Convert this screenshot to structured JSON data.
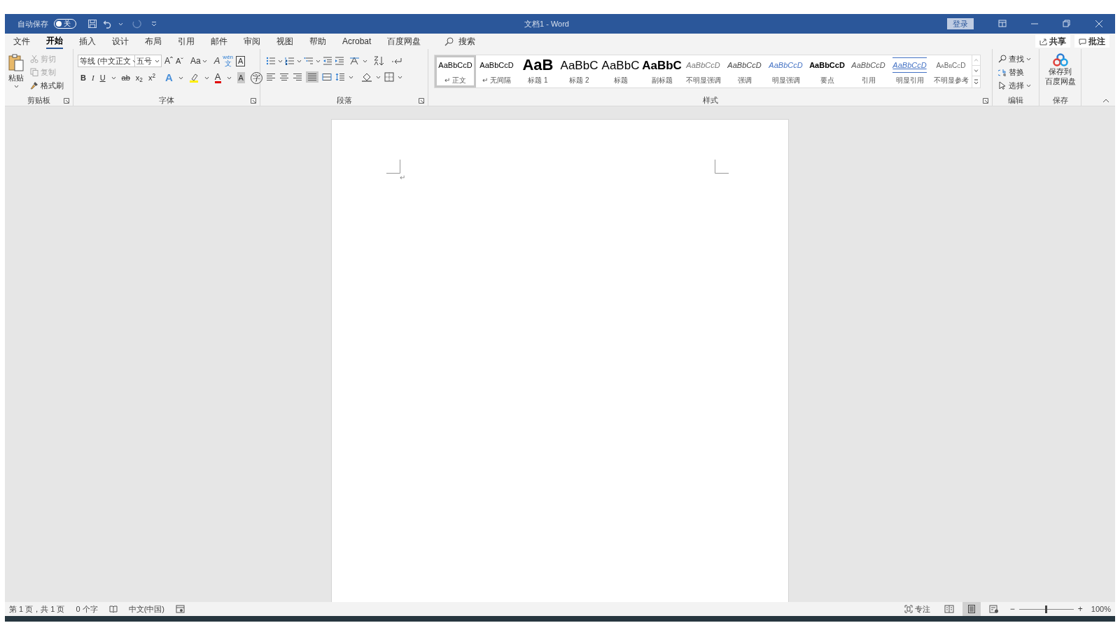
{
  "title_bar": {
    "autosave_label": "自动保存",
    "autosave": {
      "on": false,
      "label": "关"
    },
    "title": "文档1 - Word",
    "sign_in": "登录"
  },
  "tabs": [
    {
      "label": "文件",
      "selected": false
    },
    {
      "label": "开始",
      "selected": true
    },
    {
      "label": "插入",
      "selected": false
    },
    {
      "label": "设计",
      "selected": false
    },
    {
      "label": "布局",
      "selected": false
    },
    {
      "label": "引用",
      "selected": false
    },
    {
      "label": "邮件",
      "selected": false
    },
    {
      "label": "审阅",
      "selected": false
    },
    {
      "label": "视图",
      "selected": false
    },
    {
      "label": "帮助",
      "selected": false
    },
    {
      "label": "Acrobat",
      "selected": false
    },
    {
      "label": "百度网盘",
      "selected": false
    }
  ],
  "search": {
    "label": "搜索"
  },
  "share": "共享",
  "comments": "批注",
  "ribbon": {
    "clipboard": {
      "paste": "粘贴",
      "cut": {
        "label": "剪切",
        "disabled": true
      },
      "copy": {
        "label": "复制",
        "disabled": true
      },
      "format_painter": "格式刷",
      "group": "剪贴板"
    },
    "font": {
      "font_name": "等线 (中文正文",
      "font_size": "五号",
      "grow": "Aˆ",
      "shrink": "Aˇ",
      "change_case": "Aa",
      "clear": "A",
      "phonetic": {
        "ruby": "wén",
        "label": "文"
      },
      "border": "A",
      "format_buttons": [
        "B",
        "I",
        "U",
        "ab",
        "x$_{2}$",
        "x$^{2}$"
      ],
      "text_effect": "A",
      "font_color": "A",
      "shading": "A",
      "enclose": "字",
      "group": "字体"
    },
    "paragraph": {
      "group": "段落"
    },
    "styles": {
      "group": "样式",
      "items": [
        {
          "kind": "normal",
          "preview": "AaBbCcD",
          "label": "↵ 正文",
          "selected": true
        },
        {
          "kind": "normal",
          "preview": "AaBbCcD",
          "label": "↵ 无间隔",
          "selected": false
        },
        {
          "kind": "heading1",
          "preview": "AaB",
          "label": "标题 1",
          "selected": false
        },
        {
          "kind": "heading2",
          "preview": "AaBbC",
          "label": "标题 2",
          "selected": false
        },
        {
          "kind": "title",
          "preview": "AaBbC",
          "label": "标题",
          "selected": false
        },
        {
          "kind": "subtitle",
          "preview": "AaBbC",
          "label": "副标题",
          "selected": false
        },
        {
          "kind": "subtle-emphasis",
          "preview": "AaBbCcD",
          "label": "不明显强调",
          "selected": false
        },
        {
          "kind": "emphasis",
          "preview": "AaBbCcD",
          "label": "强调",
          "selected": false
        },
        {
          "kind": "intense-emphasis",
          "preview": "AaBbCcD",
          "label": "明显强调",
          "selected": false
        },
        {
          "kind": "strong",
          "preview": "AaBbCcD",
          "label": "要点",
          "selected": false
        },
        {
          "kind": "quote",
          "preview": "AaBbCcD",
          "label": "引用",
          "selected": false
        },
        {
          "kind": "intense-quote",
          "preview": "AaBbCcD",
          "label": "明显引用",
          "selected": false
        },
        {
          "kind": "subtle-reference",
          "preview": "AaBbCcD",
          "label": "不明显参考",
          "selected": false
        }
      ]
    },
    "editing": {
      "find": "查找",
      "replace": "替换",
      "select": "选择",
      "group": "编辑"
    },
    "save": {
      "lines": [
        "保存到",
        "百度网盘"
      ],
      "group": "保存"
    }
  },
  "document": {
    "paragraph_mark": "↵"
  },
  "status_bar": {
    "page": "第 1 页，共 1 页",
    "words": "0 个字",
    "language": "中文(中国)",
    "focus": "专注",
    "zoom_out": "−",
    "zoom_in": "+",
    "zoom_slider": {
      "level": 0.5
    },
    "zoom": "100%"
  }
}
